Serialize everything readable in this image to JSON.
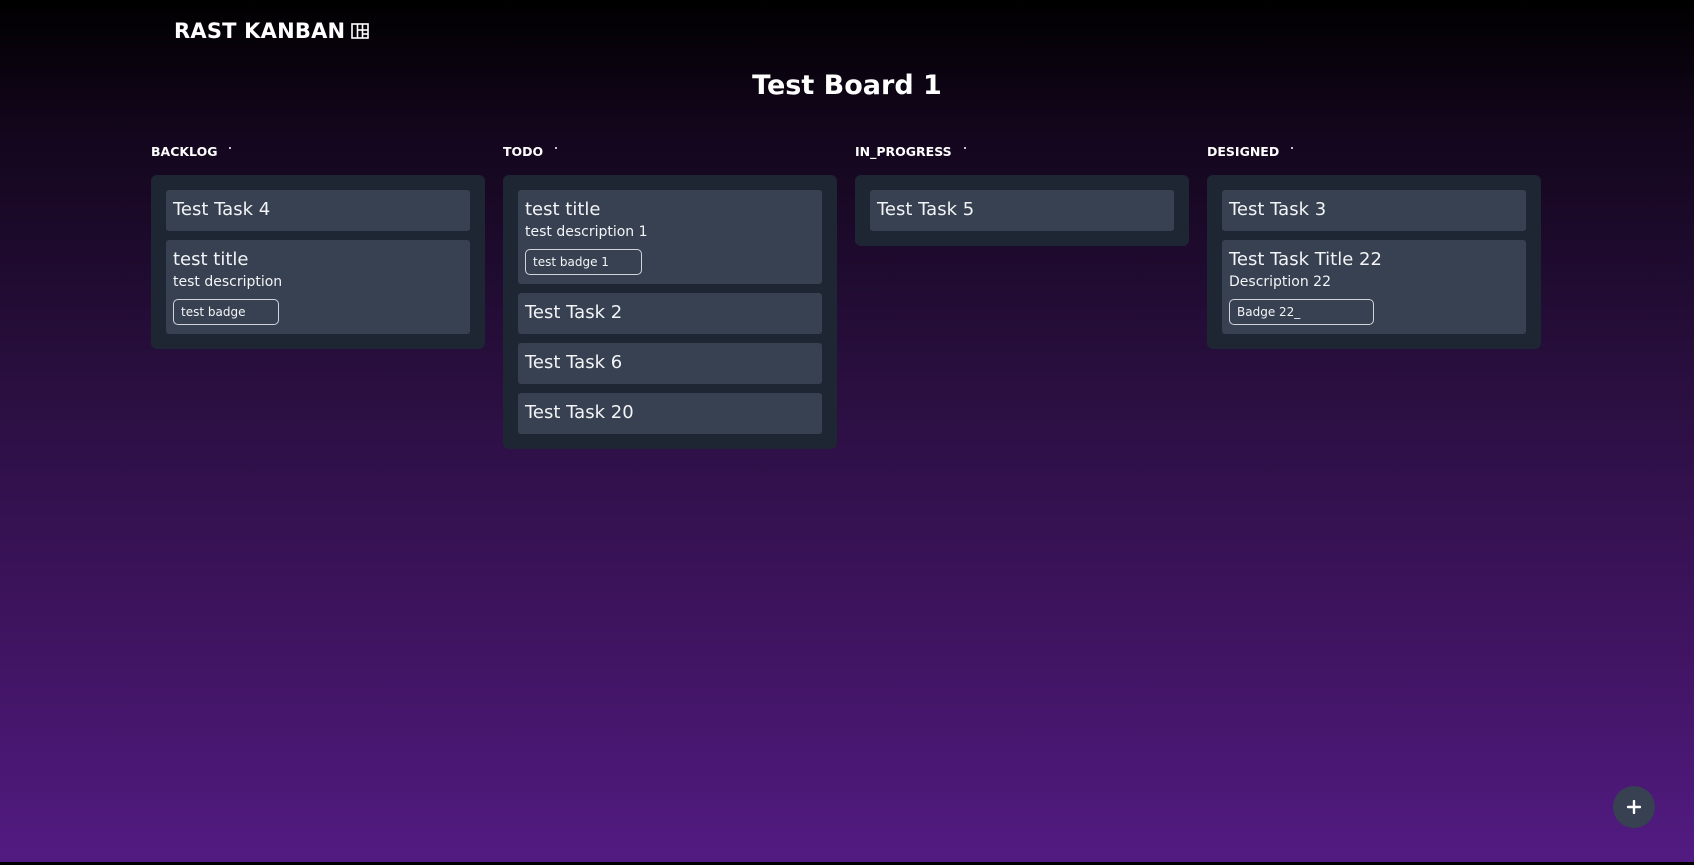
{
  "app": {
    "brand": "RAST KANBAN",
    "brand_icon": "kanban-board-icon"
  },
  "board": {
    "title": "Test Board 1"
  },
  "columns": [
    {
      "name": "BACKLOG",
      "cards": [
        {
          "title": "Test Task 4"
        },
        {
          "title": "test title",
          "description": "test description",
          "badge": "test badge"
        }
      ]
    },
    {
      "name": "TODO",
      "cards": [
        {
          "title": "test title",
          "description": "test description 1",
          "badge": "test badge 1"
        },
        {
          "title": "Test Task 2"
        },
        {
          "title": "Test Task 6"
        },
        {
          "title": "Test Task 20"
        }
      ]
    },
    {
      "name": "IN_PROGRESS",
      "cards": [
        {
          "title": "Test Task 5"
        }
      ]
    },
    {
      "name": "DESIGNED",
      "cards": [
        {
          "title": "Test Task 3"
        },
        {
          "title": "Test Task Title 22",
          "description": "Description 22",
          "badge": "Badge 22_"
        }
      ]
    }
  ],
  "fab": {
    "icon": "plus-icon"
  },
  "colors": {
    "column_bg": "#1f2633",
    "card_bg": "#374151",
    "fab_bg": "#374151",
    "gradient_bottom": "#521b82"
  }
}
